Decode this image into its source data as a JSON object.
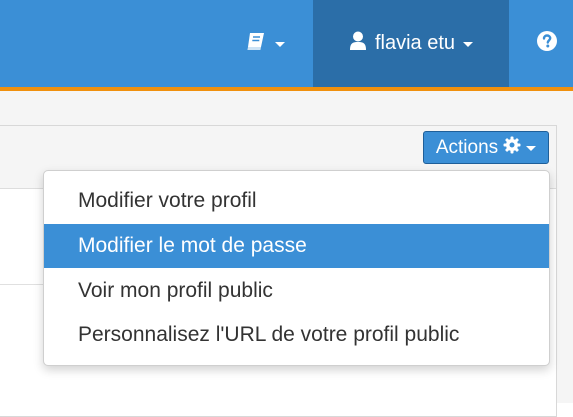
{
  "navbar": {
    "docs_icon": "book-icon",
    "user": {
      "icon": "user-icon",
      "name": "flavia etu"
    },
    "help_icon": "question-circle-icon",
    "colors": {
      "bar": "#3b8fd6",
      "active": "#2b6ea8",
      "accent_border": "#f0900d"
    }
  },
  "actions": {
    "label": "Actions",
    "icon": "gear-icon",
    "menu": [
      {
        "label": "Modifier votre profil",
        "active": false
      },
      {
        "label": "Modifier le mot de passe",
        "active": true
      },
      {
        "label": "Voir mon profil public",
        "active": false
      },
      {
        "label": "Personnalisez l'URL de votre profil public",
        "active": false
      }
    ]
  }
}
